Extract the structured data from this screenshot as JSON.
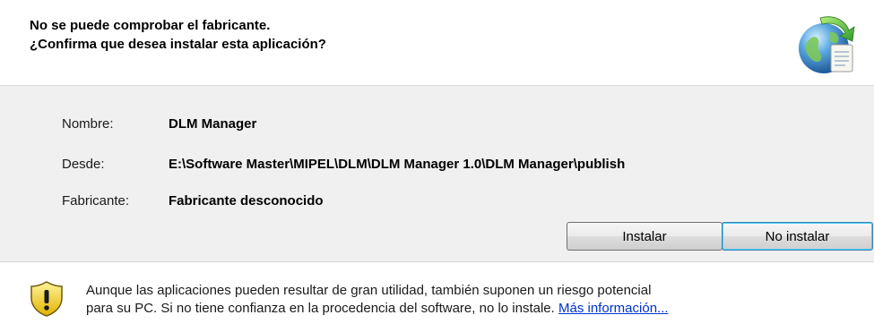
{
  "header": {
    "line1": "No se puede comprobar el fabricante.",
    "line2": "¿Confirma que desea instalar esta aplicación?",
    "icon": "globe-install-icon"
  },
  "details": {
    "name_label": "Nombre:",
    "name_value": "DLM Manager",
    "from_label": "Desde:",
    "from_value": "E:\\Software Master\\MIPEL\\DLM\\DLM Manager 1.0\\DLM Manager\\publish",
    "publisher_label": "Fabricante:",
    "publisher_value": "Fabricante desconocido"
  },
  "buttons": {
    "install_label": "Instalar",
    "no_install_label": "No instalar"
  },
  "footer": {
    "icon": "warning-shield-icon",
    "line1": "Aunque las aplicaciones pueden resultar de gran utilidad, también suponen un riesgo potencial",
    "line2_prefix": "para su PC. Si no tiene confianza en la procedencia del software, no lo instale. ",
    "more_info_link": "Más información..."
  },
  "colors": {
    "link": "#0033cc",
    "body_bg": "#f0f0f0",
    "default_button_border": "#3c7fb1"
  }
}
